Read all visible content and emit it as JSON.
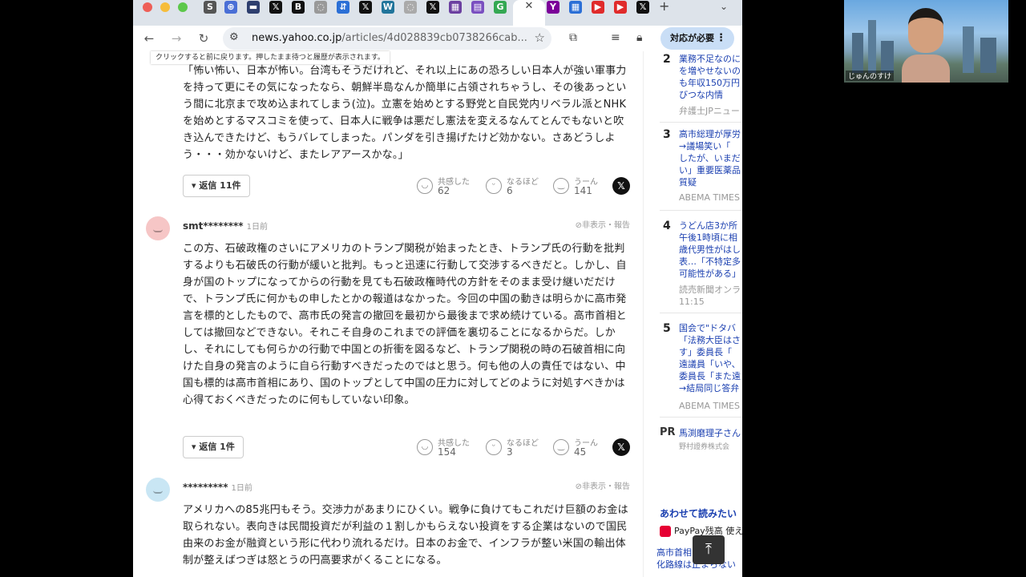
{
  "browser": {
    "address": {
      "domain": "news.yahoo.co.jp",
      "path": "/articles/4d028839cb0738266cab..."
    },
    "action_button": "対応が必要",
    "back_tooltip": "クリックすると前に戻ります。押したまま待つと履歴が表示されます。",
    "tab_icons": [
      "S",
      "⊕",
      "▬",
      "𝕏",
      "B",
      "◌",
      "⇵",
      "𝕏",
      "W",
      "◌",
      "𝕏",
      "▦",
      "▤",
      "G",
      "Y",
      "▦",
      "▶",
      "▶",
      "𝕏"
    ]
  },
  "comments": [
    {
      "user": "",
      "time": "",
      "report": "",
      "text": "「怖い怖い、日本が怖い。台湾もそうだけれど、それ以上にあの恐ろしい日本人が強い軍事力を持って更にその気になったなら、朝鮮半島なんか簡単に占領されちゃうし、その後あっという間に北京まで攻め込まれてしまう(泣)。立憲を始めとする野党と自民党内リベラル派とNHKを始めとするマスコミを使って、日本人に戦争は悪だし憲法を変えるなんてとんでもないと吹き込んできたけど、もうバレてしまった。パンダを引き揚げたけど効かない。さあどうしよう・・・効かないけど、またレアアースかな。」",
      "reply_label": "▾ 返信 11件",
      "reactions": [
        {
          "label": "共感した",
          "count": "62"
        },
        {
          "label": "なるほど",
          "count": "6"
        },
        {
          "label": "うーん",
          "count": "141"
        }
      ]
    },
    {
      "user": "smt********",
      "time": "1日前",
      "report": "⊘非表示・報告",
      "text": "この方、石破政権のさいにアメリカのトランプ関税が始まったとき、トランプ氏の行動を批判するよりも石破氏の行動が緩いと批判。もっと迅速に行動して交渉するべきだと。しかし、自身が国のトップになってからの行動を見ても石破政権時代の方針をそのまま受け継いだだけで、トランプ氏に何かもの申したとかの報道はなかった。今回の中国の動きは明らかに高市発言を標的としたもので、高市氏の発言の撤回を最初から最後まで求め続けている。高市首相としては撤回などできない。それこそ自身のこれまでの評価を裏切ることになるからだ。しかし、それにしても何らかの行動で中国との折衝を図るなど、トランプ関税の時の石破首相に向けた自身の発言のように自ら行動すべきだったのではと思う。何も他の人の責任ではない、中国も標的は高市首相にあり、国のトップとして中国の圧力に対してどのように対処すべきかは心得ておくべきだったのに何もしていない印象。",
      "reply_label": "▾ 返信 1件",
      "reactions": [
        {
          "label": "共感した",
          "count": "154"
        },
        {
          "label": "なるほど",
          "count": "3"
        },
        {
          "label": "うーん",
          "count": "45"
        }
      ]
    },
    {
      "user": "*********",
      "time": "1日前",
      "report": "⊘非表示・報告",
      "text": "アメリカへの85兆円もそう。交渉力があまりにひくい。戦争に負けてもこれだけ巨額のお金は取られない。表向きは民間投資だが利益の１割しかもらえない投資をする企業はないので国民由来のお金が融資という形に代わり流れるだけ。日本のお金で、インフラが整い米国の輸出体制が整えばつぎは怒とうの円高要求がくることになる。"
    }
  ],
  "sidebar": {
    "ranking": [
      {
        "num": "2",
        "title": "業務不足なのに\nを増やせないの\nも年収150万円\nびつな内情",
        "source": "弁護士JPニュー"
      },
      {
        "num": "3",
        "title": "高市総理が厚労\n→議場笑い「\nしたが、いまだ\nい」重要医薬品\n質疑",
        "source": "ABEMA TIMES"
      },
      {
        "num": "4",
        "title": "うどん店3か所\n午後1時頃に相\n歳代男性がはし\n表…「不特定多\n可能性がある」",
        "source": "読売新聞オンラ\n11:15"
      },
      {
        "num": "5",
        "title": "国会で\"ドタバ\n「法務大臣はさ\nす」委員長「\n遠議員「いや、\n委員長「また遠\n→結局同じ答弁",
        "source": "ABEMA TIMES"
      }
    ],
    "pr": {
      "label": "PR",
      "title": "馬渕磨理子さん",
      "source": "野村證券株式会"
    },
    "also_read": "あわせて読みたい",
    "paypay": "PayPay残高 使え",
    "last_item": "高市首相の\"\n化路線は止まらない"
  },
  "webcam": {
    "name": "じゅんのすけ"
  }
}
